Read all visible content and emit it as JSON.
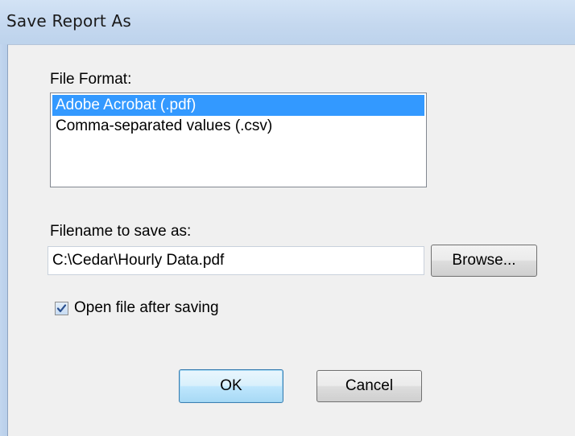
{
  "window": {
    "title": "Save Report As"
  },
  "file_format": {
    "label": "File Format:",
    "options": [
      {
        "label": "Adobe Acrobat (.pdf)",
        "selected": true
      },
      {
        "label": "Comma-separated values (.csv)",
        "selected": false
      }
    ]
  },
  "filename": {
    "label": "Filename to save as:",
    "value": "C:\\Cedar\\Hourly Data.pdf",
    "browse_label": "Browse..."
  },
  "open_after": {
    "label": "Open file after saving",
    "checked": true
  },
  "buttons": {
    "ok_label": "OK",
    "cancel_label": "Cancel"
  },
  "colors": {
    "selection": "#3399ff",
    "titlebar": "#c5d8ef",
    "dialog_bg": "#f0f0f0"
  },
  "icons": {
    "checkbox": "checkmark-icon"
  }
}
